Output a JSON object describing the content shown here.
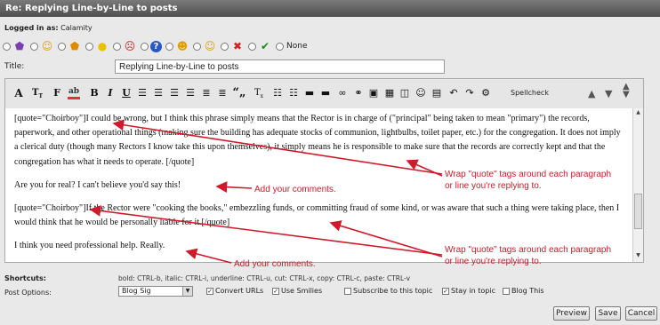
{
  "window": {
    "title": "Re: Replying Line-by-Line to posts"
  },
  "login": {
    "label": "Logged in as:",
    "user": "Calamity"
  },
  "post_icons": {
    "items": [
      {
        "name": "purple-shield-icon",
        "glyph": "🛡",
        "color": "#7b3fb3"
      },
      {
        "name": "smiley-face-icon",
        "glyph": "☺",
        "color": "#e0a000"
      },
      {
        "name": "orange-shield-icon",
        "glyph": "🛡",
        "color": "#e08a00"
      },
      {
        "name": "lightbulb-icon",
        "glyph": "💡",
        "color": "#e6c200"
      },
      {
        "name": "angry-face-icon",
        "glyph": "☹",
        "color": "#cc2222"
      },
      {
        "name": "question-icon",
        "glyph": "?",
        "color": "#2a56c6"
      },
      {
        "name": "grin-face-icon",
        "glyph": "☺",
        "color": "#e0a000"
      },
      {
        "name": "cool-face-icon",
        "glyph": "☺",
        "color": "#e0a000"
      },
      {
        "name": "red-x-icon",
        "glyph": "✖",
        "color": "#d42020"
      },
      {
        "name": "green-check-icon",
        "glyph": "✔",
        "color": "#1a8c1a"
      }
    ],
    "none_label": "None"
  },
  "title_field": {
    "label": "Title:",
    "value": "Replying Line-by-Line to posts"
  },
  "toolbar": {
    "spellcheck_label": "Spellcheck",
    "buttons": [
      "A",
      "T",
      "F",
      "🎨",
      "B",
      "I",
      "U",
      "≡",
      "≡",
      "≡",
      "≡",
      "≣",
      "≣",
      "“„",
      "Tx",
      "☰",
      "☰",
      "▬",
      "∞",
      "⚭",
      "▣",
      "☐",
      "☺",
      "▦",
      "↶",
      "↷",
      "⚙"
    ]
  },
  "content": {
    "paragraphs": [
      "[quote=\"Choirboy\"]I could be wrong, but I think this phrase simply means that the Rector is in charge of (\"principal\" being taken to mean \"primary\") the records, paperwork, and other operational things (making sure the building has adequate stocks of communion, lightbulbs, toilet paper, etc.) for the congregation. It does not imply a clerical duty (though many Rectors I know take this upon themselves), it simply means he is responsible to make sure that the records are correctly kept and that the congregation has what it needs to operate. [/quote]",
      "Are you for real? I can't believe you'd say this!",
      "[quote=\"Choirboy\"]If the Rector were \"cooking the books,\" embezzling funds, or committing fraud of some kind, or was aware that such a thing were taking place, then I would think that he would be personally liable for it.[/quote]",
      "I think you need professional help. Really."
    ]
  },
  "annotations": {
    "wrap_1_line1": "Wrap \"quote\" tags around each paragraph",
    "wrap_1_line2": "or line you're replying to.",
    "comments_1": "Add your comments.",
    "wrap_2_line1": "Wrap \"quote\" tags around each paragraph",
    "wrap_2_line2": "or line you're replying to.",
    "comments_2": "Add your comments.",
    "color": "#d0192a"
  },
  "shortcuts": {
    "label": "Shortcuts:",
    "text": "bold: CTRL-b, italic: CTRL-i, underline: CTRL-u, cut: CTRL-x, copy: CTRL-c, paste: CTRL-v"
  },
  "post_options": {
    "label": "Post Options:",
    "signature_select": "Blog Sig",
    "checkboxes": [
      {
        "label": "Convert URLs",
        "checked": true
      },
      {
        "label": "Use Smilies",
        "checked": true
      },
      {
        "label": "Subscribe to this topic",
        "checked": false
      },
      {
        "label": "Stay in topic",
        "checked": true
      },
      {
        "label": "Blog This",
        "checked": false
      }
    ]
  },
  "buttons": {
    "preview": "Preview",
    "save": "Save",
    "cancel": "Cancel"
  }
}
